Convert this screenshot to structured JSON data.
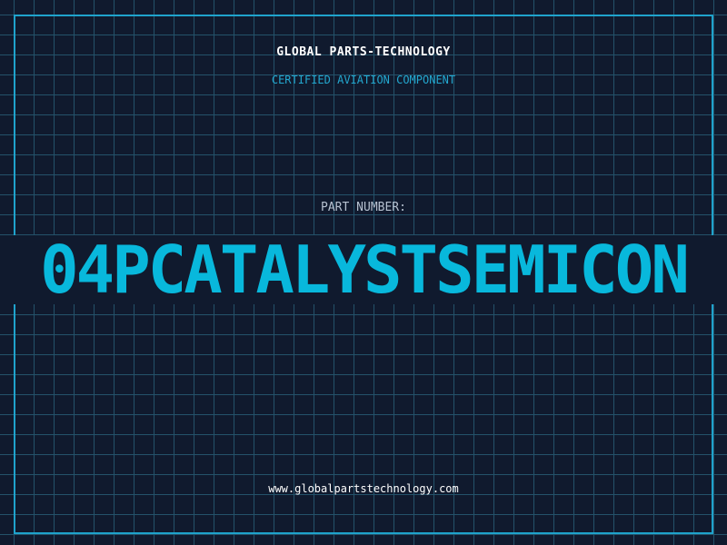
{
  "header": {
    "brand": "GLOBAL PARTS-TECHNOLOGY",
    "subtitle": "CERTIFIED AVIATION COMPONENT"
  },
  "part": {
    "label": "PART NUMBER:",
    "number": "04PCATALYSTSEMICON"
  },
  "footer": {
    "url": "www.globalpartstechnology.com"
  },
  "colors": {
    "background": "#101a2e",
    "grid": "#24526a",
    "accent": "#08b8dc",
    "border": "#1fa3cc",
    "text": "#ffffff"
  }
}
